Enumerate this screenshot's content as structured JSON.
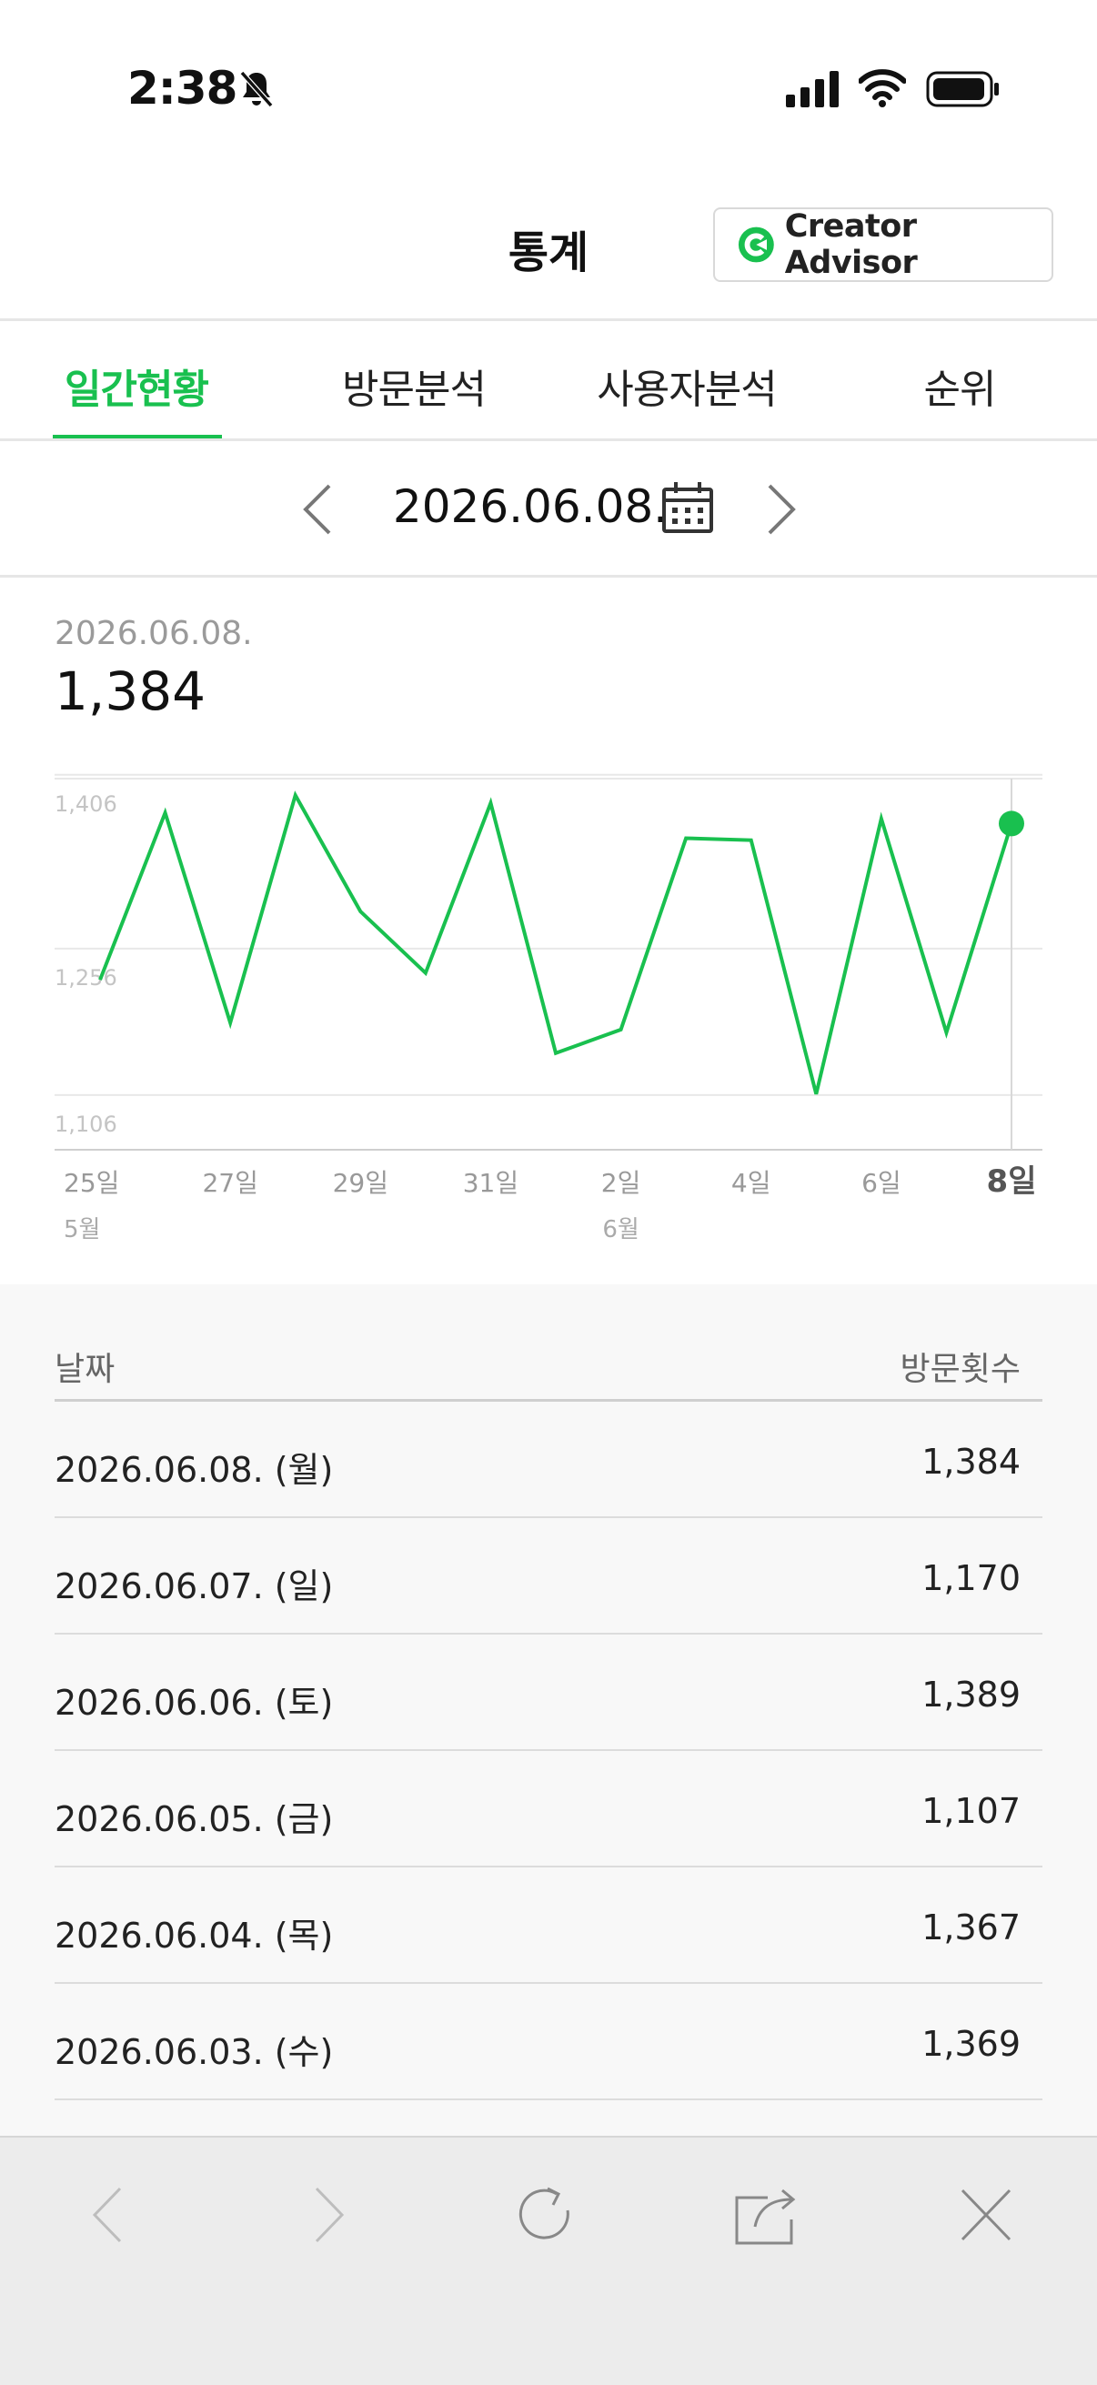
{
  "status_bar": {
    "time": "2:38"
  },
  "header": {
    "title": "통계",
    "creator_advisor_label": "Creator Advisor"
  },
  "tabs": [
    {
      "label": "일간현황",
      "active": true
    },
    {
      "label": "방문분석",
      "active": false
    },
    {
      "label": "사용자분석",
      "active": false
    },
    {
      "label": "순위",
      "active": false
    }
  ],
  "date_nav": {
    "date": "2026.06.08."
  },
  "summary": {
    "date": "2026.06.08.",
    "value": "1,384"
  },
  "chart_data": {
    "type": "line",
    "title": "",
    "y_ticks": [
      "1,406",
      "1,256",
      "1,106"
    ],
    "x_tick_labels": [
      "25일",
      "27일",
      "29일",
      "31일",
      "2일",
      "4일",
      "6일",
      "8일"
    ],
    "x_month_labels": [
      {
        "at": "25일",
        "label": "5월"
      },
      {
        "at": "2일",
        "label": "6월"
      }
    ],
    "x": [
      "5/25",
      "5/26",
      "5/27",
      "5/28",
      "5/29",
      "5/30",
      "5/31",
      "6/1",
      "6/2",
      "6/3",
      "6/4",
      "6/5",
      "6/6",
      "6/7",
      "6/8"
    ],
    "values": [
      1224,
      1395,
      1180,
      1413,
      1294,
      1231,
      1405,
      1149,
      1173,
      1369,
      1367,
      1107,
      1389,
      1170,
      1384
    ],
    "ylim": [
      1050,
      1430
    ],
    "highlight": "6/8",
    "color": "#19c04f",
    "grid": true
  },
  "table": {
    "header_date": "날짜",
    "header_visits": "방문횟수",
    "rows": [
      {
        "date": "2026.06.08. (월)",
        "value": "1,384"
      },
      {
        "date": "2026.06.07. (일)",
        "value": "1,170"
      },
      {
        "date": "2026.06.06. (토)",
        "value": "1,389"
      },
      {
        "date": "2026.06.05. (금)",
        "value": "1,107"
      },
      {
        "date": "2026.06.04. (목)",
        "value": "1,367"
      },
      {
        "date": "2026.06.03. (수)",
        "value": "1,369"
      }
    ]
  },
  "toolbar": {
    "icons": [
      "back-icon",
      "forward-icon",
      "reload-icon",
      "share-icon",
      "close-icon"
    ]
  }
}
